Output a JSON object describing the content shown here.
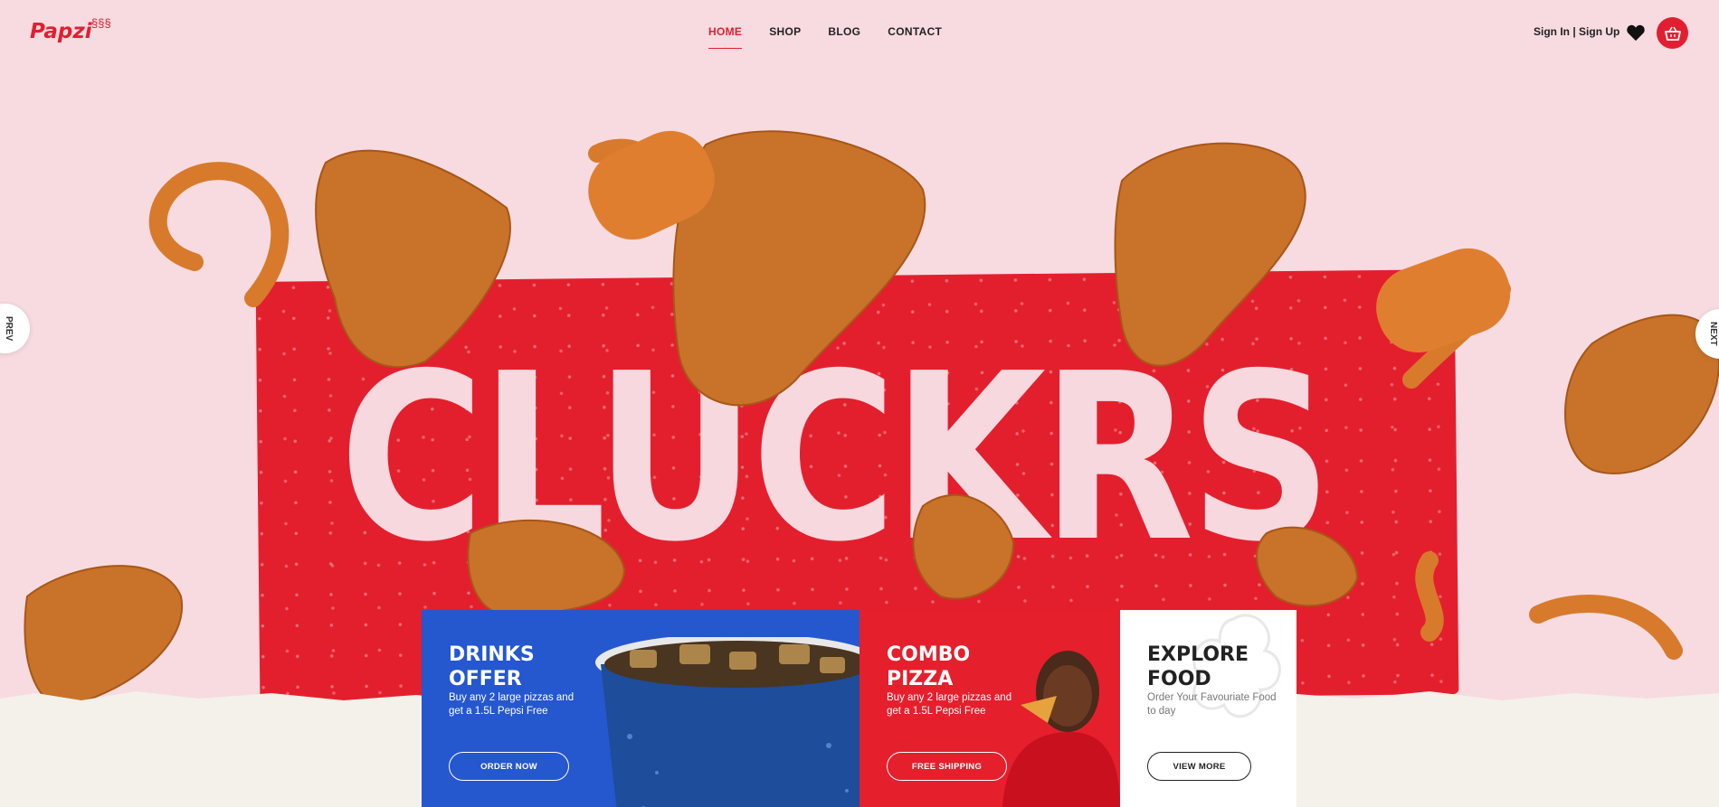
{
  "brand": {
    "logo": "Papzi",
    "logo_mark": "§§§"
  },
  "nav": {
    "items": [
      "HOME",
      "SHOP",
      "BLOG",
      "CONTACT"
    ],
    "active": "HOME"
  },
  "header": {
    "auth_label": "Sign In | Sign Up"
  },
  "hero": {
    "banner_text": "CLUCKRS",
    "prev_label": "PREV",
    "next_label": "NEXT"
  },
  "promos": [
    {
      "title_line1": "DRINKS",
      "title_line2": "OFFER",
      "text": "Buy any 2 large pizzas and get a 1.5L Pepsi Free",
      "button": "ORDER NOW",
      "color": "#2557cf"
    },
    {
      "title_line1": "COMBO",
      "title_line2": "PIZZA",
      "text": "Buy any 2 large pizzas and get a 1.5L Pepsi Free",
      "button": "FREE SHIPPING",
      "color": "#e51f2c"
    },
    {
      "title_line1": "EXPLORE",
      "title_line2": "FOOD",
      "text": "Order Your Favouriate Food to day",
      "button": "VIEW MORE",
      "color": "#ffffff"
    }
  ],
  "colors": {
    "accent": "#e21f30",
    "hero_bg": "#f7dbe1"
  },
  "icons": {
    "wishlist": "heart-icon",
    "cart": "basket-icon"
  }
}
